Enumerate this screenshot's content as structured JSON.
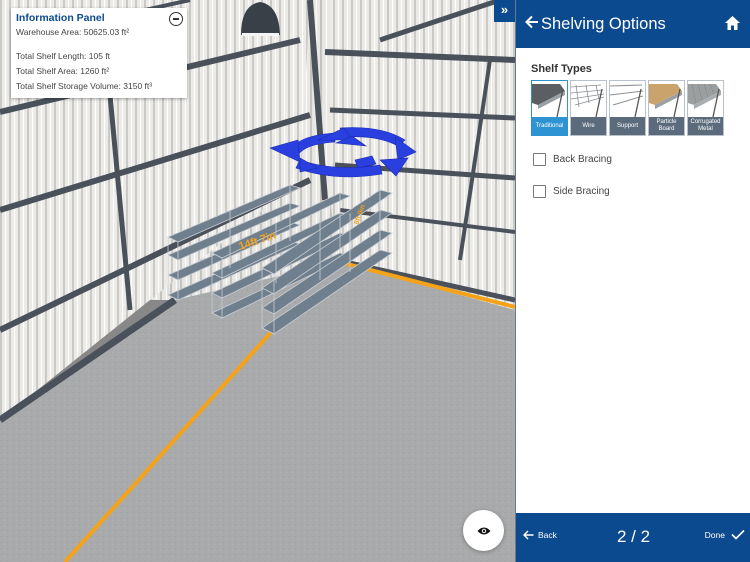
{
  "info_panel": {
    "title": "Information Panel",
    "warehouse_area": "Warehouse Area: 50625.03 ft²",
    "total_shelf_length": "Total Shelf Length: 105 ft",
    "total_shelf_area": "Total Shelf Area: 1260 ft²",
    "total_shelf_storage_volume": "Total Shelf Storage Volume: 3150 ft³",
    "collapse_icon": "minus-circle-icon"
  },
  "scene": {
    "dimension_label_length": "14ft 7in",
    "dimension_label_depth": "8ft 0in",
    "rotate_gizmo_icon": "rotate-arrows-icon",
    "view_button_icon": "eye-icon",
    "colors": {
      "floor": "#a8a9aa",
      "wall": "#ececea",
      "beam": "#4a515b",
      "guide_line": "#f5a21b",
      "shelf": "#6f7f8d",
      "gizmo": "#2a3fe0"
    }
  },
  "sidebar_toggle": {
    "icon": "double-chevron-right-icon",
    "label": "»"
  },
  "panel": {
    "header": {
      "back_icon": "arrow-left-icon",
      "title": "Shelving Options",
      "home_icon": "home-icon"
    },
    "shelf_types_label": "Shelf Types",
    "shelf_types": [
      {
        "label": "Traditional",
        "selected": true
      },
      {
        "label": "Wire",
        "selected": false
      },
      {
        "label": "Support",
        "selected": false
      },
      {
        "label": "Particle Board",
        "selected": false
      },
      {
        "label": "Corrugated Metal",
        "selected": false
      }
    ],
    "options": [
      {
        "label": "Back Bracing",
        "checked": false
      },
      {
        "label": "Side Bracing",
        "checked": false
      }
    ],
    "footer": {
      "back_label": "Back",
      "page_indicator": "2 / 2",
      "done_label": "Done"
    },
    "colors": {
      "primary": "#0c4a8f",
      "selected": "#2e93d2",
      "tile_label_bg": "#5b6b7c"
    }
  }
}
